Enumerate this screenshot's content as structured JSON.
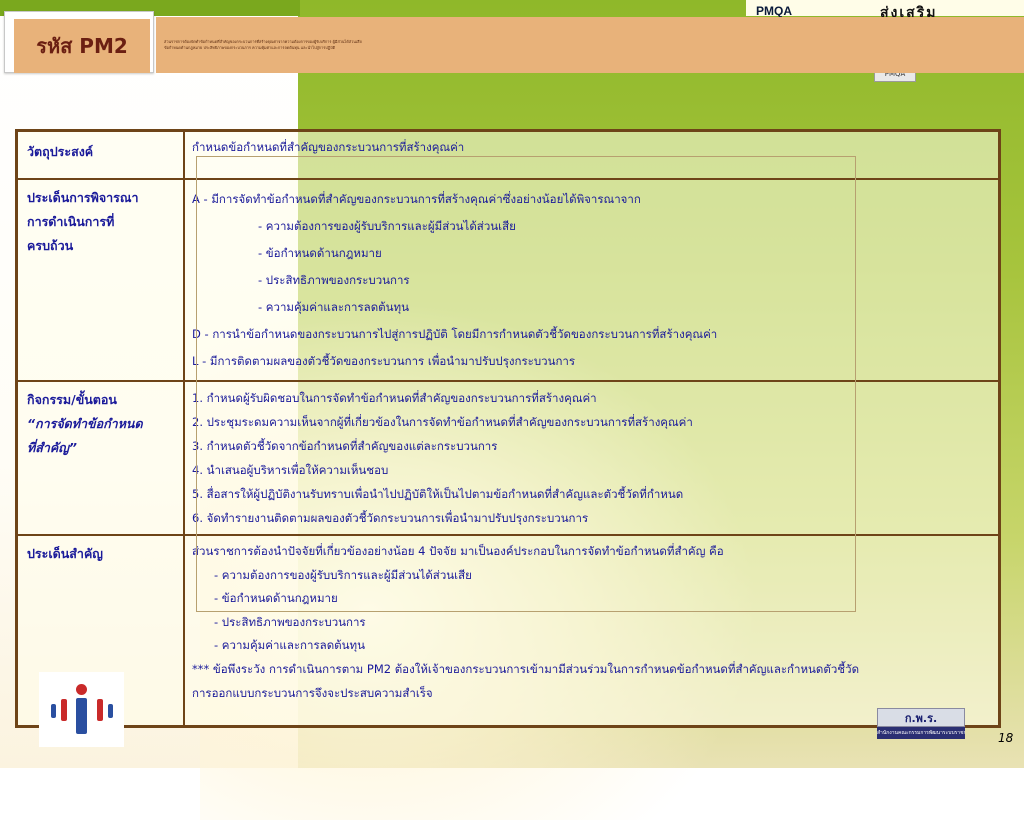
{
  "header": {
    "code": "รหัส PM2",
    "desc_line1": "ส่วนราชการต้องจัดทำข้อกำหนดที่สำคัญของกระบวนการที่สร้างคุณค่าจากความต้องการของผู้รับบริการ ผู้มีส่วนได้ส่วนเสีย",
    "desc_line2": "ข้อกำหนดด้านกฎหมาย ประสิทธิภาพของกระบวนการ ความคุ้มค่าและการลดต้นทุน และนำไปสู่การปฏิบัติ"
  },
  "logo": {
    "pmqa": "PMQA",
    "pmqa_small": "PMQA",
    "swoosh": "ส่งเสริม"
  },
  "table": {
    "rows": [
      {
        "label": "วัตถุประสงค์",
        "lines": [
          "กำหนดข้อกำหนดที่สำคัญของกระบวนการที่สร้างคุณค่า"
        ]
      },
      {
        "label_lines": [
          "ประเด็นการพิจารณา",
          "การดำเนินการที่",
          "ครบถ้วน"
        ],
        "lines": [
          "A - มีการจัดทำข้อกำหนดที่สำคัญของกระบวนการที่สร้างคุณค่าซึ่งอย่างน้อยได้พิจารณาจาก",
          "- ความต้องการของผู้รับบริการและผู้มีส่วนได้ส่วนเสีย",
          "- ข้อกำหนดด้านกฎหมาย",
          "- ประสิทธิภาพของกระบวนการ",
          "- ความคุ้มค่าและการลดต้นทุน",
          "D - การนำข้อกำหนดของกระบวนการไปสู่การปฏิบัติ โดยมีการกำหนดตัวชี้วัดของกระบวนการที่สร้างคุณค่า",
          "L - มีการติดตามผลของตัวชี้วัดของกระบวนการ เพื่อนำมาปรับปรุงกระบวนการ"
        ]
      },
      {
        "label_lines": [
          "กิจกรรม/ขั้นตอน",
          "“การจัดทำข้อกำหนด",
          "ที่สำคัญ”"
        ],
        "lines": [
          "1. กำหนดผู้รับผิดชอบในการจัดทำข้อกำหนดที่สำคัญของกระบวนการที่สร้างคุณค่า",
          "2. ประชุมระดมความเห็นจากผู้ที่เกี่ยวข้องในการจัดทำข้อกำหนดที่สำคัญของกระบวนการที่สร้างคุณค่า",
          "3. กำหนดตัวชี้วัดจากข้อกำหนดที่สำคัญของแต่ละกระบวนการ",
          "4. นำเสนอผู้บริหารเพื่อให้ความเห็นชอบ",
          "5. สื่อสารให้ผู้ปฏิบัติงานรับทราบเพื่อนำไปปฏิบัติให้เป็นไปตามข้อกำหนดที่สำคัญและตัวชี้วัดที่กำหนด",
          "6. จัดทำรายงานติดตามผลของตัวชี้วัดกระบวนการเพื่อนำมาปรับปรุงกระบวนการ"
        ]
      },
      {
        "label": "ประเด็นสำคัญ",
        "lines": [
          "ส่วนราชการต้องนำปัจจัยที่เกี่ยวข้องอย่างน้อย 4 ปัจจัย มาเป็นองค์ประกอบในการจัดทำข้อกำหนดที่สำคัญ คือ",
          "- ความต้องการของผู้รับบริการและผู้มีส่วนได้ส่วนเสีย",
          "- ข้อกำหนดด้านกฎหมาย",
          "- ประสิทธิภาพของกระบวนการ",
          "- ความคุ้มค่าและการลดต้นทุน",
          "*** ข้อพึงระวัง   การดำเนินการตาม PM2 ต้องให้เจ้าของกระบวนการเข้ามามีส่วนร่วมในการกำหนดข้อกำหนดที่สำคัญและกำหนดตัวชี้วัด",
          "การออกแบบกระบวนการจึงจะประสบความสำเร็จ"
        ]
      }
    ]
  },
  "footer": {
    "badge_top": "ก.พ.ร.",
    "badge_bottom": "สำนักงานคณะกรรมการพัฒนาระบบราชการ",
    "page_number": "18"
  }
}
